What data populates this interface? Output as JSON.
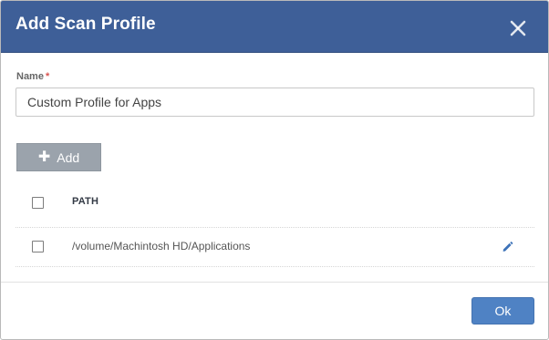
{
  "dialog": {
    "title": "Add Scan Profile",
    "close_icon": "close-icon"
  },
  "form": {
    "name_label": "Name",
    "required_marker": "*",
    "name_value": "Custom Profile for Apps"
  },
  "toolbar": {
    "add_icon": "plus-icon",
    "add_label": "Add"
  },
  "table": {
    "columns": [
      "PATH"
    ],
    "rows": [
      {
        "path": "/volume/Machintosh HD/Applications",
        "checked": false,
        "action_icon": "pencil-icon"
      }
    ]
  },
  "footer": {
    "ok_label": "Ok"
  },
  "colors": {
    "header_bg": "#3e5f98",
    "primary_button": "#4f82c4",
    "add_button": "#9ba3ac",
    "required": "#d9534f"
  }
}
